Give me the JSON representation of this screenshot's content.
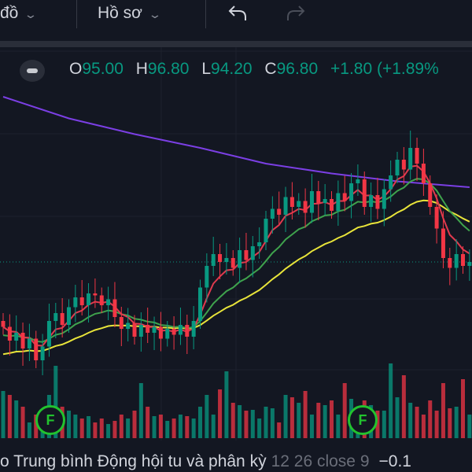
{
  "toolbar": {
    "chart_menu_label": "đồ",
    "profile_menu_label": "Hồ sơ",
    "undo_icon": "undo-arrow",
    "redo_icon": "redo-arrow"
  },
  "legend": {
    "o_label": "O",
    "o_value": "95.00",
    "h_label": "H",
    "h_value": "96.80",
    "l_label": "L",
    "l_value": "94.20",
    "c_label": "C",
    "c_value": "96.80",
    "change": "+1.80 (+1.89%"
  },
  "indicator": {
    "name": "o Trung bình Động hội tu và phân kỳ",
    "params": "12 26 close 9",
    "value": "−0.1"
  },
  "markers": [
    {
      "label": "F"
    },
    {
      "label": "F"
    }
  ],
  "colors": {
    "up": "#089981",
    "down": "#f23645",
    "ma_purple": "#7b3fe4",
    "ma_yellow": "#e8e43a",
    "ma_green": "#3fa34d",
    "ma_red": "#e03a4e",
    "marker": "#22c32e"
  },
  "chart_data": {
    "type": "candlestick",
    "last_price": 96.8,
    "closes": [
      93.5,
      92.8,
      93.2,
      92.4,
      92.9,
      91.8,
      92.5,
      93.8,
      94.2,
      93.6,
      94.5,
      95.0,
      94.6,
      95.2,
      95.1,
      94.6,
      94.9,
      94.0,
      93.4,
      93.7,
      93.0,
      93.6,
      93.2,
      93.5,
      92.9,
      93.4,
      93.1,
      93.6,
      93.0,
      93.8,
      95.5,
      96.6,
      97.2,
      96.8,
      97.0,
      96.5,
      97.4,
      96.9,
      97.6,
      97.8,
      99.0,
      99.5,
      99.2,
      100.1,
      99.6,
      99.9,
      99.3,
      100.4,
      99.8,
      100.0,
      99.4,
      100.3,
      99.9,
      100.8,
      101.0,
      99.6,
      100.2,
      99.5,
      100.5,
      101.2,
      102.0,
      101.5,
      102.6,
      101.8,
      100.8,
      99.6,
      98.5,
      97.0,
      96.5,
      97.2,
      96.6,
      96.8
    ],
    "volumes": [
      60,
      55,
      48,
      40,
      20,
      30,
      18,
      55,
      92,
      40,
      35,
      30,
      25,
      28,
      20,
      25,
      18,
      22,
      30,
      25,
      35,
      70,
      40,
      28,
      30,
      22,
      25,
      30,
      28,
      25,
      40,
      55,
      30,
      62,
      85,
      45,
      42,
      35,
      36,
      25,
      40,
      38,
      20,
      55,
      52,
      45,
      60,
      30,
      45,
      42,
      48,
      30,
      70,
      50,
      30,
      48,
      42,
      35,
      35,
      95,
      52,
      80,
      45,
      40,
      30,
      48,
      35,
      70,
      38,
      40,
      75,
      30
    ],
    "ma_purple": [
      [
        0,
        105.2
      ],
      [
        10,
        104.1
      ],
      [
        20,
        103.3
      ],
      [
        30,
        102.6
      ],
      [
        40,
        101.8
      ],
      [
        50,
        101.3
      ],
      [
        60,
        100.9
      ],
      [
        71,
        100.6
      ]
    ],
    "ma_periods": {
      "red": 5,
      "green": 12,
      "yellow": 26
    }
  }
}
